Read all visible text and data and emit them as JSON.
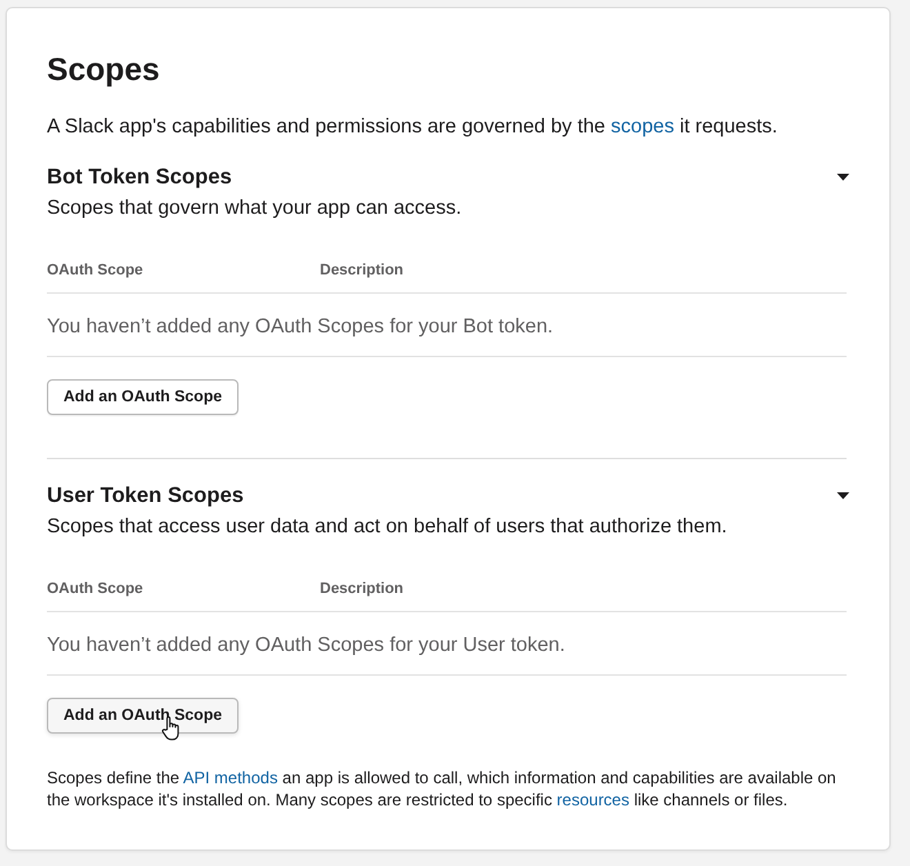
{
  "heading": {
    "title": "Scopes",
    "intro": [
      {
        "kind": "text",
        "text": "A Slack app's capabilities and permissions are governed by the "
      },
      {
        "kind": "link",
        "text": "scopes"
      },
      {
        "kind": "text",
        "text": " it requests."
      }
    ]
  },
  "sections": [
    {
      "title": "Bot Token Scopes",
      "subtitle": "Scopes that govern what your app can access.",
      "expanded": true,
      "columns": [
        "OAuth Scope",
        "Description"
      ],
      "empty_message": "You haven’t added any OAuth Scopes for your Bot token.",
      "button": {
        "label": "Add an OAuth Scope",
        "hovered": false
      }
    },
    {
      "title": "User Token Scopes",
      "subtitle": "Scopes that access user data and act on behalf of users that authorize them.",
      "expanded": true,
      "columns": [
        "OAuth Scope",
        "Description"
      ],
      "empty_message": "You haven’t added any OAuth Scopes for your User token.",
      "button": {
        "label": "Add an OAuth Scope",
        "hovered": true
      }
    }
  ],
  "footer": [
    {
      "kind": "text",
      "text": "Scopes define the "
    },
    {
      "kind": "link",
      "text": "API methods"
    },
    {
      "kind": "text",
      "text": " an app is allowed to call, which information and capabilities are available on the workspace it's installed on. Many scopes are restricted to specific "
    },
    {
      "kind": "link",
      "text": "resources"
    },
    {
      "kind": "text",
      "text": " like channels or files."
    }
  ]
}
